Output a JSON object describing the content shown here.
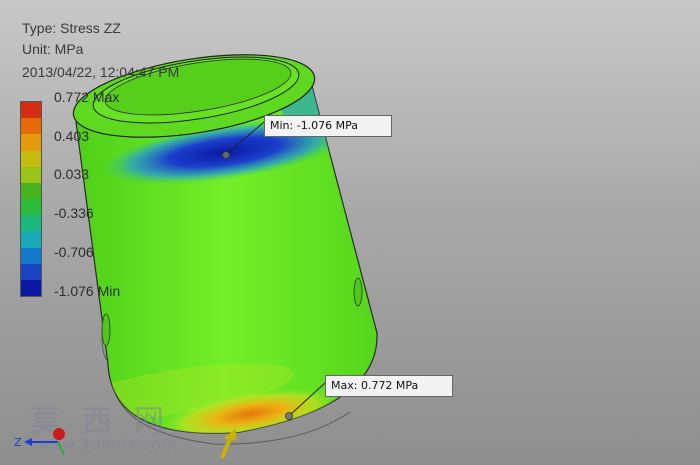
{
  "result": {
    "type": "Type: Stress ZZ",
    "unit": "Unit: MPa",
    "timestamp": "2013/04/22, 12:04:47 PM"
  },
  "legend": {
    "labels": [
      "0.772 Max",
      "0.403",
      "0.033",
      "-0.336",
      "-0.706",
      "-1.076 Min"
    ],
    "colors": [
      "#d42d0f",
      "#e46a06",
      "#e49a0a",
      "#c6bc10",
      "#9bc41b",
      "#45b31e",
      "#2bbc3a",
      "#1bb87c",
      "#18abb5",
      "#137ac9",
      "#1a45c2",
      "#0b1aa5"
    ]
  },
  "probes": {
    "min": "Min: -1.076 MPa",
    "max": "Max: 0.772 MPa"
  },
  "triad": {
    "z_label": "Z"
  },
  "watermark": {
    "chinese": "莫西网",
    "url": "www.3dmox.com"
  }
}
